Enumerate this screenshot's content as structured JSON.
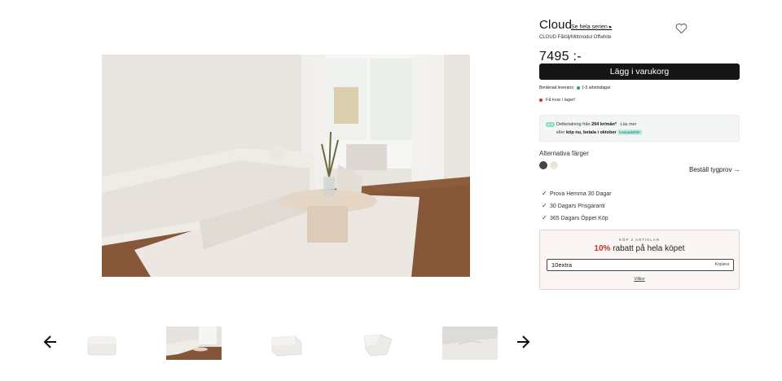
{
  "product": {
    "title": "Cloud",
    "series_link": "Se hela serien ▸",
    "subtitle": "CLOUD Fåtölj/Mittmodul Offwhite",
    "price": "7495 :-",
    "favorite_icon": "heart-icon"
  },
  "cart": {
    "label": "Lägg i varukorg"
  },
  "delivery": {
    "label": "Beräknad leverans:",
    "value": "1-5 arbetsdagar",
    "status_color": "#2f9e57"
  },
  "stock": {
    "text": "Få kvar i lager!",
    "status_color": "#d22c2c"
  },
  "payment": {
    "line1_prefix": "Delbetalning från",
    "amount": "294 kr/mån*",
    "read_more": "Läs mer",
    "line2_prefix": "eller",
    "line2_bold": "köp nu, betala i oktober",
    "tag": "kostnadsfritt*"
  },
  "colors": {
    "label": "Alternativa färger",
    "swatches": [
      "#4a4541",
      "#ece4d7"
    ],
    "fabric_link": "Beställ tygprov →"
  },
  "usps": [
    "Prova Hemma 30 Dagar",
    "30 Dagars Prisgaranti",
    "365 Dagars Öppet Köp"
  ],
  "promo": {
    "kicker": "KÖP 2 ARTIKLAR",
    "percent": "10%",
    "headline": "rabatt på hela köpet",
    "code": "10extra",
    "copy_label": "Kopiera",
    "terms": "Villkor"
  },
  "gallery": {
    "prev_icon": "arrow-left-icon",
    "next_icon": "arrow-right-icon",
    "thumbnail_count": 5
  }
}
